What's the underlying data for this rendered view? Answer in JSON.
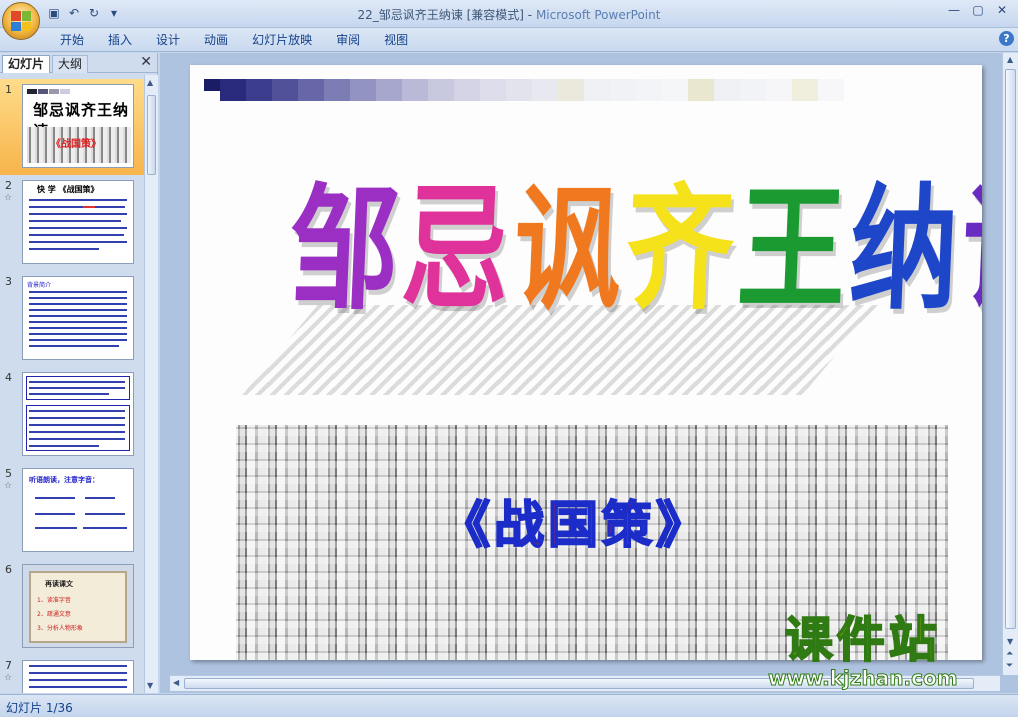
{
  "window": {
    "title": "22_邹忌讽齐王纳谏 [兼容模式]",
    "app_name": "Microsoft PowerPoint",
    "title_separator": " - "
  },
  "quick_access": {
    "save_icon": "save-icon",
    "undo_icon": "undo-icon",
    "redo_icon": "redo-icon",
    "customize_icon": "customize-qat-icon"
  },
  "ribbon": {
    "tabs": [
      {
        "label": "开始"
      },
      {
        "label": "插入"
      },
      {
        "label": "设计"
      },
      {
        "label": "动画"
      },
      {
        "label": "幻灯片放映"
      },
      {
        "label": "审阅"
      },
      {
        "label": "视图"
      }
    ],
    "help_label": "?"
  },
  "left_pane": {
    "tab_slides": "幻灯片",
    "tab_outline": "大纲",
    "close_label": "✕",
    "thumbnails": [
      {
        "num": "1",
        "title": "邹忌讽齐王纳谏",
        "subtitle": "《战国策》"
      },
      {
        "num": "2",
        "title": "快 学 《战国策》"
      },
      {
        "num": "3",
        "title": "背景简介"
      },
      {
        "num": "4",
        "title": ""
      },
      {
        "num": "5",
        "title": "听语朗读，注意字音："
      },
      {
        "num": "6",
        "title": "再读课文",
        "items": [
          "1、读准字音",
          "2、疏通文意",
          "3、分析人物形象"
        ]
      },
      {
        "num": "7",
        "title": ""
      }
    ]
  },
  "slide": {
    "title_chars": [
      "邹",
      "忌",
      "讽",
      "齐",
      "王",
      "纳",
      "谏"
    ],
    "title_colors": [
      "#9b2fc4",
      "#e0329b",
      "#f0781e",
      "#f5e21a",
      "#1c9a32",
      "#1e46c8",
      "#6a2bc2"
    ],
    "subtitle": "《战国策》"
  },
  "watermark": {
    "text": "课件站",
    "url": "www.kjzhan.com"
  },
  "status_bar": {
    "slide_info": "幻灯片 1/36"
  }
}
